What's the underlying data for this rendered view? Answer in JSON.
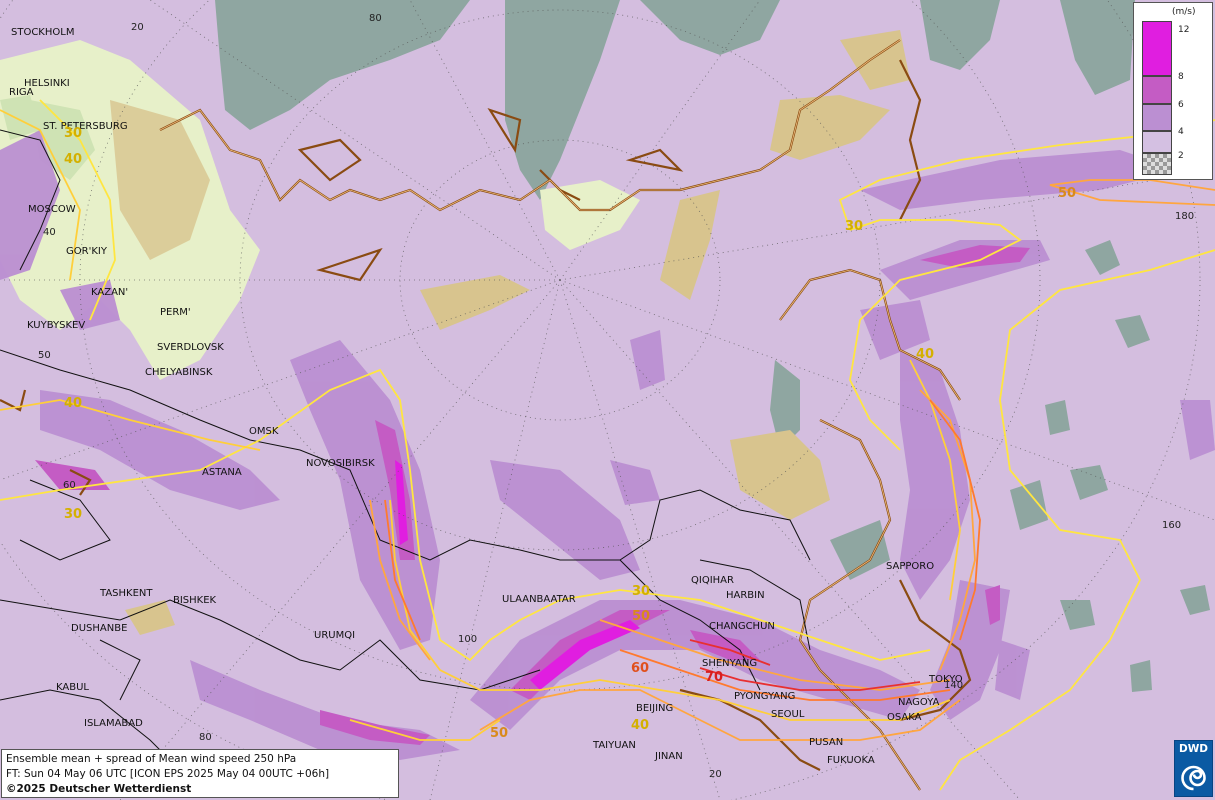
{
  "map": {
    "cities": [
      {
        "name": "STOCKHOLM"
      },
      {
        "name": "HELSINKI"
      },
      {
        "name": "RIGA"
      },
      {
        "name": "ST. PETERSBURG"
      },
      {
        "name": "MOSCOW"
      },
      {
        "name": "GOR'KIY"
      },
      {
        "name": "KAZAN'"
      },
      {
        "name": "KUYBYSKEV"
      },
      {
        "name": "PERM'"
      },
      {
        "name": "SVERDLOVSK"
      },
      {
        "name": "CHELYABINSK"
      },
      {
        "name": "OMSK"
      },
      {
        "name": "NOVOSIBIRSK"
      },
      {
        "name": "ASTANA"
      },
      {
        "name": "TASHKENT"
      },
      {
        "name": "BISHKEK"
      },
      {
        "name": "DUSHANBE"
      },
      {
        "name": "URUMQI"
      },
      {
        "name": "ULAANBAATAR"
      },
      {
        "name": "KABUL"
      },
      {
        "name": "ISLAMABAD"
      },
      {
        "name": "QIQIHAR"
      },
      {
        "name": "HARBIN"
      },
      {
        "name": "CHANGCHUN"
      },
      {
        "name": "SHENYANG"
      },
      {
        "name": "PYONGYANG"
      },
      {
        "name": "SEOUL"
      },
      {
        "name": "BEIJING"
      },
      {
        "name": "TAIYUAN"
      },
      {
        "name": "JINAN"
      },
      {
        "name": "PUSAN"
      },
      {
        "name": "FUKUOKA"
      },
      {
        "name": "OSAKA"
      },
      {
        "name": "NAGOYA"
      },
      {
        "name": "TOKYO"
      },
      {
        "name": "SAPPORO"
      }
    ],
    "grid_labels": [
      "20",
      "80",
      "40",
      "50",
      "60",
      "100",
      "80",
      "180",
      "160",
      "20",
      "140"
    ],
    "contour_labels": [
      {
        "text": "30",
        "color": "#d4b000"
      },
      {
        "text": "40",
        "color": "#d4b000"
      },
      {
        "text": "40",
        "color": "#d4b000"
      },
      {
        "text": "30",
        "color": "#d4b000"
      },
      {
        "text": "30",
        "color": "#d4b000"
      },
      {
        "text": "50",
        "color": "#d98a1c"
      },
      {
        "text": "60",
        "color": "#e0501c"
      },
      {
        "text": "70",
        "color": "#d81e1e"
      },
      {
        "text": "40",
        "color": "#d4b000"
      },
      {
        "text": "50",
        "color": "#d98a1c"
      },
      {
        "text": "30",
        "color": "#d4b000"
      },
      {
        "text": "40",
        "color": "#d4b000"
      },
      {
        "text": "50",
        "color": "#d98a1c"
      }
    ]
  },
  "legend": {
    "unit": "(m/s)",
    "levels": [
      {
        "label": "12",
        "color": "#e01ee0"
      },
      {
        "label": "8",
        "color": "#c45cc4"
      },
      {
        "label": "6",
        "color": "#bb8fd2"
      },
      {
        "label": "4",
        "color": "#d4c0e2"
      },
      {
        "label": "2",
        "color": "checker"
      }
    ]
  },
  "info": {
    "line1": "Ensemble mean + spread of Mean wind speed 250 hPa",
    "line2": "FT: Sun 04 May 06 UTC [ICON EPS 2025 May 04 00UTC +06h]",
    "line3": "©2025 Deutscher Wetterdienst"
  },
  "logo": {
    "text": "DWD"
  },
  "colors": {
    "contour_30": "#ffe640",
    "contour_40": "#ffcf3a",
    "contour_50": "#ffa640",
    "contour_60": "#ff7a2e",
    "contour_70": "#e83030",
    "spread_low": "#d4c0e2",
    "spread_mid": "#bb8fd2",
    "spread_high": "#c45cc4",
    "spread_max": "#e01ee0",
    "terrain_low": "#e7f0c9",
    "terrain_high": "#d8c48e",
    "water": "#8fa6a1"
  }
}
